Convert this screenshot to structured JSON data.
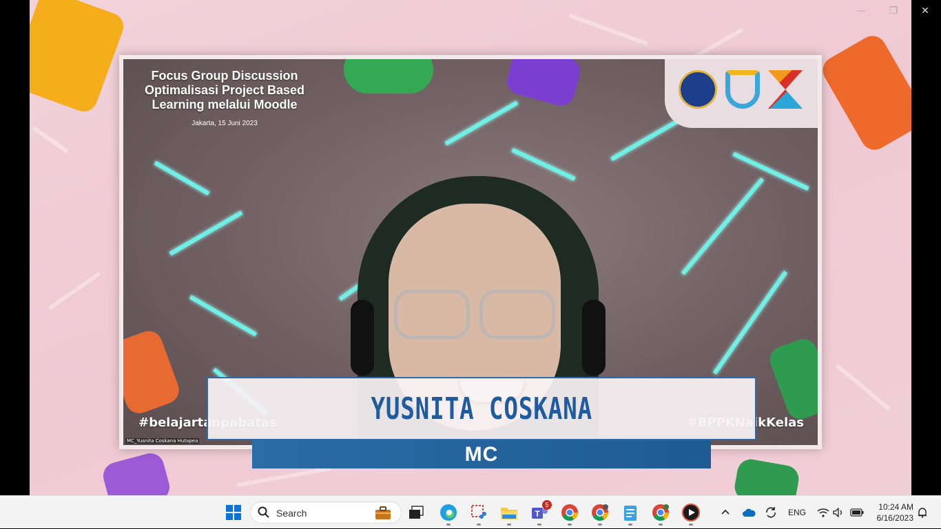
{
  "presentation": {
    "title_lines": [
      "Focus Group Discussion",
      "Optimalisasi Project Based",
      "Learning melalui Moodle"
    ],
    "date": "Jakarta, 15 Juni 2023",
    "hashtag_left": "#belajartanpabatas",
    "hashtag_right": "#BPPKNaikKelas",
    "participant_label": "MC_Yusnita Coskana Hutapea",
    "speaker_name": "YUSNITA COSKANA",
    "speaker_role": "MC"
  },
  "window_controls": {
    "minimize": "—",
    "restore": "❐",
    "close": "✕"
  },
  "taskbar": {
    "search_label": "Search",
    "teams_badge": "5",
    "tray": {
      "language": "ENG",
      "time": "10:24 AM",
      "date": "6/16/2023"
    }
  },
  "colors": {
    "name_text": "#1f5b9e",
    "role_bar": "#2c6ba6",
    "maze_glow": "#6ef0e6",
    "stage_pink": "#efc9d3"
  },
  "icons": [
    "windows-start-icon",
    "search-icon",
    "work-briefcase-icon",
    "task-view-icon",
    "edge-icon",
    "snipping-tool-icon",
    "file-explorer-icon",
    "teams-icon",
    "chrome-icon",
    "chrome-profile-icon",
    "chrome-profile-2-icon",
    "notepad-icon",
    "chrome-profile-3-icon",
    "media-player-icon",
    "chevron-up-icon",
    "onedrive-icon",
    "sync-icon",
    "wifi-icon",
    "volume-icon",
    "battery-icon",
    "notification-icon"
  ]
}
